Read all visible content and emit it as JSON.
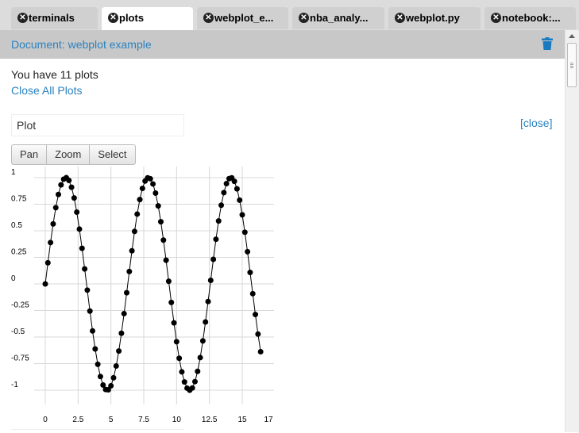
{
  "tabs": [
    {
      "label": "terminals",
      "active": false
    },
    {
      "label": "plots",
      "active": true
    },
    {
      "label": "webplot_e...",
      "active": false
    },
    {
      "label": "nba_analy...",
      "active": false
    },
    {
      "label": "webplot.py",
      "active": false
    },
    {
      "label": "notebook:...",
      "active": false
    }
  ],
  "document": {
    "title": "Document: webplot example",
    "delete_icon": "trash-icon"
  },
  "plots_panel": {
    "count_text": "You have 11 plots",
    "close_all_label": "Close All Plots"
  },
  "plot": {
    "name_value": "Plot",
    "close_label": "[close]",
    "tools": [
      "Pan",
      "Zoom",
      "Select"
    ]
  },
  "colors": {
    "link": "#2b82c0",
    "docbar": "#c8c8c8",
    "tabbar": "#dcdcdc",
    "point": "#000000"
  },
  "chart_data": {
    "type": "scatter",
    "title": "",
    "xlabel": "",
    "ylabel": "",
    "series": [
      {
        "mode": "line+markers",
        "function": "sin",
        "x_start": 0,
        "x_end": 16.5,
        "step": 0.2
      }
    ],
    "xticks": [
      "0",
      "2.5",
      "5",
      "7.5",
      "10",
      "12.5",
      "15",
      "17"
    ],
    "yticks": [
      "1",
      "0.75",
      "0.5",
      "0.25",
      "0",
      "-0.25",
      "-0.5",
      "-0.75",
      "-1"
    ],
    "xlim": [
      -1,
      17
    ],
    "ylim": [
      -1.05,
      1.05
    ],
    "grid": true
  }
}
